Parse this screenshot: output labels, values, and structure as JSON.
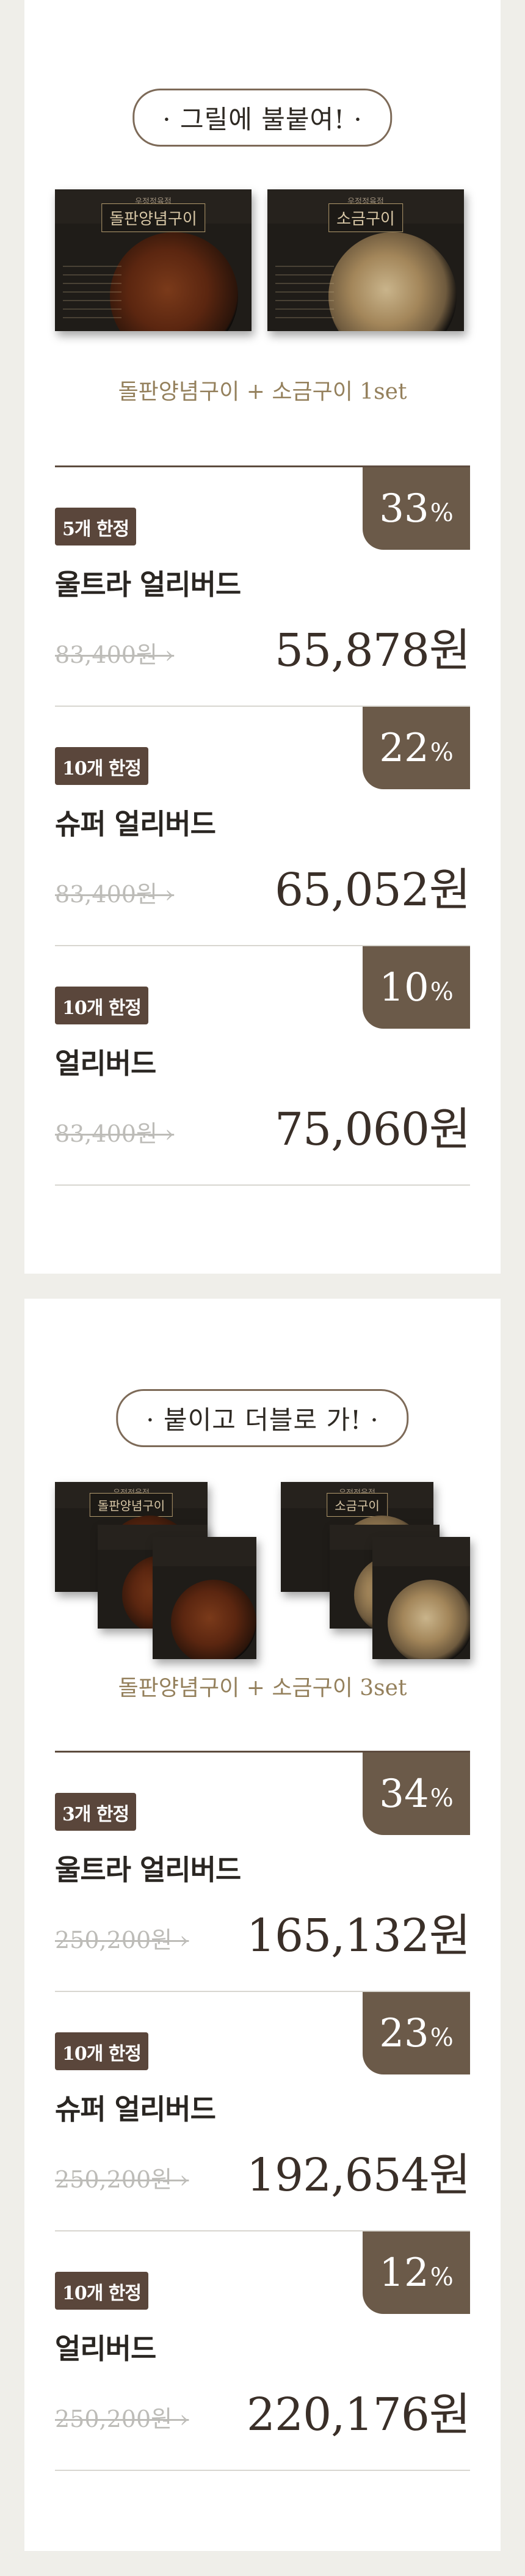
{
  "sections": [
    {
      "heading": "· 그릴에 불붙여! ·",
      "packages": [
        {
          "brand": "우정정육점",
          "title": "돌판양념구이",
          "type": "spicy"
        },
        {
          "brand": "우정정육점",
          "title": "소금구이",
          "type": "salt"
        }
      ],
      "subtitle": "돌판양념구이 + 소금구이 1set",
      "offers": [
        {
          "badge": "5개 한정",
          "discount": "33",
          "pct": "%",
          "tier": "울트라 얼리버드",
          "original": "83,400원 ›",
          "price": "55,878원"
        },
        {
          "badge": "10개 한정",
          "discount": "22",
          "pct": "%",
          "tier": "슈퍼 얼리버드",
          "original": "83,400원 ›",
          "price": "65,052원"
        },
        {
          "badge": "10개 한정",
          "discount": "10",
          "pct": "%",
          "tier": "얼리버드",
          "original": "83,400원 ›",
          "price": "75,060원"
        }
      ]
    },
    {
      "heading": "· 붙이고 더블로 가! ·",
      "packages": [
        {
          "brand": "우정정육점",
          "title": "돌판양념구이",
          "type": "spicy"
        },
        {
          "brand": "우정정육점",
          "title": "소금구이",
          "type": "salt"
        }
      ],
      "subtitle": "돌판양념구이 + 소금구이 3set",
      "offers": [
        {
          "badge": "3개 한정",
          "discount": "34",
          "pct": "%",
          "tier": "울트라 얼리버드",
          "original": "250,200원 ›",
          "price": "165,132원"
        },
        {
          "badge": "10개 한정",
          "discount": "23",
          "pct": "%",
          "tier": "슈퍼 얼리버드",
          "original": "250,200원 ›",
          "price": "192,654원"
        },
        {
          "badge": "10개 한정",
          "discount": "12",
          "pct": "%",
          "tier": "얼리버드",
          "original": "250,200원 ›",
          "price": "220,176원"
        }
      ]
    }
  ]
}
